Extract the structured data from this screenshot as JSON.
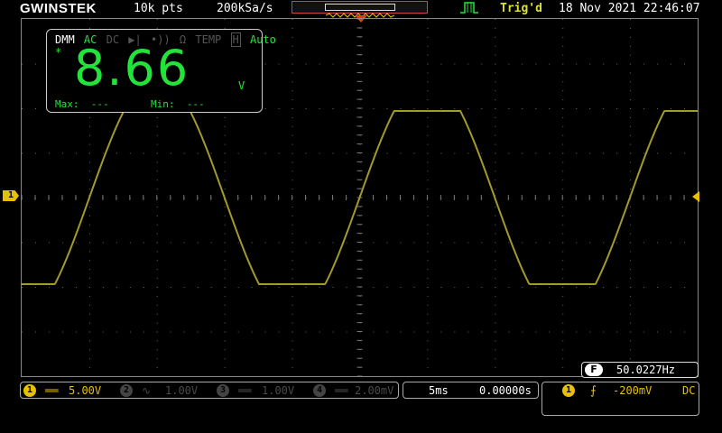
{
  "header": {
    "brand": "GWINSTEK",
    "record_length": "10k pts",
    "sample_rate": "200kSa/s",
    "trigger_status": "Trig'd",
    "datetime": "18 Nov 2021 22:46:07"
  },
  "dmm": {
    "modes": [
      "DMM",
      "AC",
      "DC",
      "TEMP",
      "Auto"
    ],
    "star": "*",
    "reading": "8.66",
    "unit": "V",
    "max_label": "Max:",
    "max_value": "---",
    "min_label": "Min:",
    "min_value": "---"
  },
  "frequency": {
    "icon_label": "F",
    "value": "50.0227Hz"
  },
  "channels": [
    {
      "num": "1",
      "coupling_symbol": "══",
      "scale": "5.00V",
      "active": true
    },
    {
      "num": "2",
      "coupling_symbol": "∿",
      "scale": "1.00V",
      "active": false
    },
    {
      "num": "3",
      "coupling_symbol": "══",
      "scale": "1.00V",
      "active": false
    },
    {
      "num": "4",
      "coupling_symbol": "══",
      "scale": "2.00mV",
      "active": false
    }
  ],
  "timebase": {
    "scale": "5ms",
    "position": "0.00000s"
  },
  "trigger": {
    "source": "1",
    "edge": "⨍",
    "level": "-200mV",
    "coupling": "DC"
  },
  "colors": {
    "ch1": "#e8c000",
    "trace": "#a39a2c",
    "dmm_green": "#22e33a",
    "trig_marker": "#e04010"
  },
  "waveform": {
    "frequency_hz": 50.0227,
    "time_per_div_ms": 5,
    "volts_per_div": 5,
    "clipped_top_volts": 9.7,
    "clipped_bottom_volts": -9.7
  }
}
